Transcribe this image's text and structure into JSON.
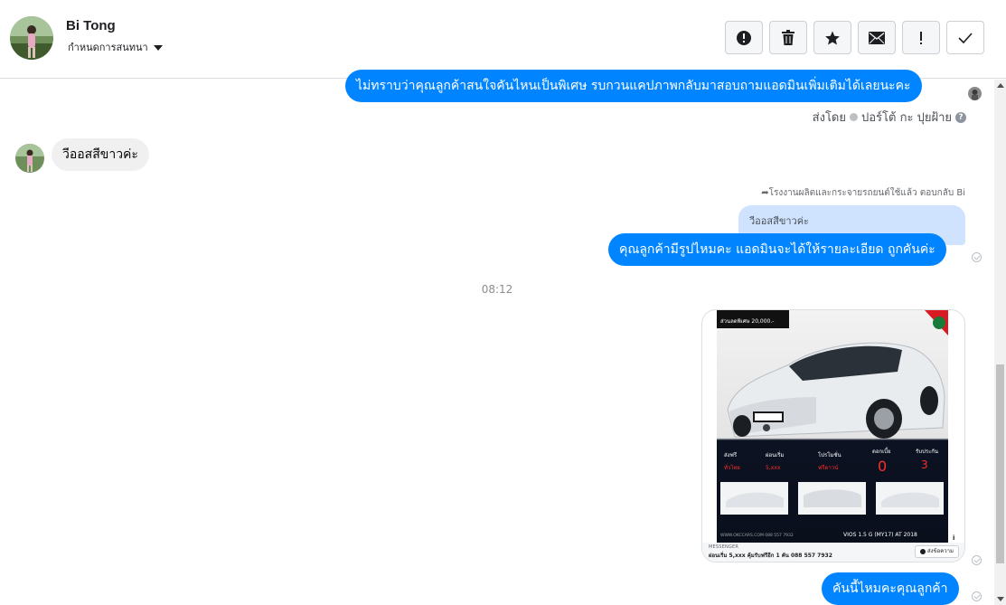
{
  "header": {
    "contact_name": "Bi Tong",
    "assign_label": "กำหนดการสนทนา",
    "actions": [
      {
        "name": "spam-button",
        "icon": "alert-circle-icon"
      },
      {
        "name": "delete-button",
        "icon": "trash-icon"
      },
      {
        "name": "star-button",
        "icon": "star-icon"
      },
      {
        "name": "mark-unread-button",
        "icon": "envelope-icon"
      },
      {
        "name": "important-button",
        "icon": "exclamation-icon"
      },
      {
        "name": "mark-done-button",
        "icon": "checkmark-icon"
      }
    ]
  },
  "messages": {
    "m1_text": "ไม่ทราบว่าคุณลูกค้าสนใจคันไหนเป็นพิเศษ รบกวนแคปภาพกลับมาสอบถามแอดมินเพิ่มเติมได้เลยนะคะ",
    "sent_by_label": "ส่งโดย",
    "sent_by_name": "ปอร์โต้ กะ ปุยฝ้าย",
    "sent_by_help": "?",
    "m2_text": "วีออสสีขาวค่ะ",
    "reply_note": "โรงงานผลิตและกระจายรถยนต์ใช้แล้ว ตอบกลับ Bi",
    "quoted_text": "วีออสสีขาวค่ะ",
    "m3_text": "คุณลูกค้ามีรูปไหมคะ แอดมินจะได้ให้รายละเอียด ถูกคันค่ะ",
    "timestamp": "08:12",
    "card": {
      "source": "MESSENGER",
      "title": "ผ่อนเริ่ม 5,xxx คุ้มรับฟรีอีก 1 คัน 088 557 7932",
      "button": "ส่งข้อความ",
      "info": "i",
      "ad_price_tag": "ส่วนลดพิเศษ 20,000.-",
      "ad_model": "VIOS 1.5 G (MY17) AT 2018",
      "ad_features": [
        "ส่งฟรี ทั่วไทย",
        "ผ่อนเริ่ม 5,xxx",
        "โปรโมชั่น ฟรีดาวน์",
        "ดอกเบี้ย 0%",
        "รับประกัน 3 ปี"
      ],
      "ad_footer": "WWW.OKCCARS.COM 088 557 7932"
    },
    "m4_text": "คันนี้ไหมคะคุณลูกค้า"
  },
  "colors": {
    "outgoing_bubble": "#0084ff",
    "incoming_bubble": "#f0f0f0",
    "quoted_bubble": "#cfe3ff"
  }
}
